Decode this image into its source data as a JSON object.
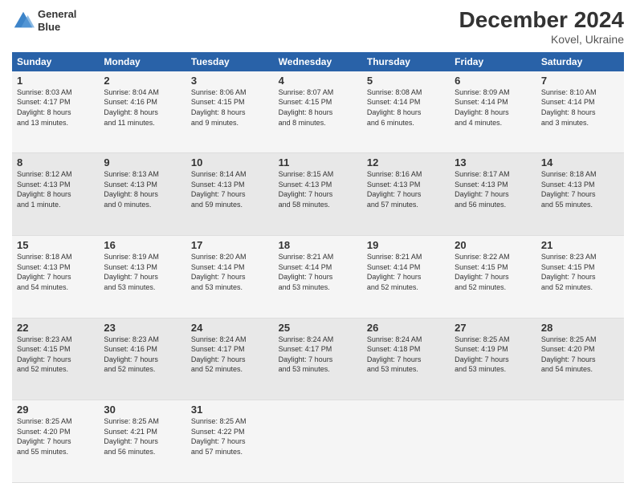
{
  "header": {
    "title": "December 2024",
    "subtitle": "Kovel, Ukraine",
    "logo_line1": "General",
    "logo_line2": "Blue"
  },
  "columns": [
    "Sunday",
    "Monday",
    "Tuesday",
    "Wednesday",
    "Thursday",
    "Friday",
    "Saturday"
  ],
  "weeks": [
    [
      {
        "day": "1",
        "info": "Sunrise: 8:03 AM\nSunset: 4:17 PM\nDaylight: 8 hours\nand 13 minutes."
      },
      {
        "day": "2",
        "info": "Sunrise: 8:04 AM\nSunset: 4:16 PM\nDaylight: 8 hours\nand 11 minutes."
      },
      {
        "day": "3",
        "info": "Sunrise: 8:06 AM\nSunset: 4:15 PM\nDaylight: 8 hours\nand 9 minutes."
      },
      {
        "day": "4",
        "info": "Sunrise: 8:07 AM\nSunset: 4:15 PM\nDaylight: 8 hours\nand 8 minutes."
      },
      {
        "day": "5",
        "info": "Sunrise: 8:08 AM\nSunset: 4:14 PM\nDaylight: 8 hours\nand 6 minutes."
      },
      {
        "day": "6",
        "info": "Sunrise: 8:09 AM\nSunset: 4:14 PM\nDaylight: 8 hours\nand 4 minutes."
      },
      {
        "day": "7",
        "info": "Sunrise: 8:10 AM\nSunset: 4:14 PM\nDaylight: 8 hours\nand 3 minutes."
      }
    ],
    [
      {
        "day": "8",
        "info": "Sunrise: 8:12 AM\nSunset: 4:13 PM\nDaylight: 8 hours\nand 1 minute."
      },
      {
        "day": "9",
        "info": "Sunrise: 8:13 AM\nSunset: 4:13 PM\nDaylight: 8 hours\nand 0 minutes."
      },
      {
        "day": "10",
        "info": "Sunrise: 8:14 AM\nSunset: 4:13 PM\nDaylight: 7 hours\nand 59 minutes."
      },
      {
        "day": "11",
        "info": "Sunrise: 8:15 AM\nSunset: 4:13 PM\nDaylight: 7 hours\nand 58 minutes."
      },
      {
        "day": "12",
        "info": "Sunrise: 8:16 AM\nSunset: 4:13 PM\nDaylight: 7 hours\nand 57 minutes."
      },
      {
        "day": "13",
        "info": "Sunrise: 8:17 AM\nSunset: 4:13 PM\nDaylight: 7 hours\nand 56 minutes."
      },
      {
        "day": "14",
        "info": "Sunrise: 8:18 AM\nSunset: 4:13 PM\nDaylight: 7 hours\nand 55 minutes."
      }
    ],
    [
      {
        "day": "15",
        "info": "Sunrise: 8:18 AM\nSunset: 4:13 PM\nDaylight: 7 hours\nand 54 minutes."
      },
      {
        "day": "16",
        "info": "Sunrise: 8:19 AM\nSunset: 4:13 PM\nDaylight: 7 hours\nand 53 minutes."
      },
      {
        "day": "17",
        "info": "Sunrise: 8:20 AM\nSunset: 4:14 PM\nDaylight: 7 hours\nand 53 minutes."
      },
      {
        "day": "18",
        "info": "Sunrise: 8:21 AM\nSunset: 4:14 PM\nDaylight: 7 hours\nand 53 minutes."
      },
      {
        "day": "19",
        "info": "Sunrise: 8:21 AM\nSunset: 4:14 PM\nDaylight: 7 hours\nand 52 minutes."
      },
      {
        "day": "20",
        "info": "Sunrise: 8:22 AM\nSunset: 4:15 PM\nDaylight: 7 hours\nand 52 minutes."
      },
      {
        "day": "21",
        "info": "Sunrise: 8:23 AM\nSunset: 4:15 PM\nDaylight: 7 hours\nand 52 minutes."
      }
    ],
    [
      {
        "day": "22",
        "info": "Sunrise: 8:23 AM\nSunset: 4:15 PM\nDaylight: 7 hours\nand 52 minutes."
      },
      {
        "day": "23",
        "info": "Sunrise: 8:23 AM\nSunset: 4:16 PM\nDaylight: 7 hours\nand 52 minutes."
      },
      {
        "day": "24",
        "info": "Sunrise: 8:24 AM\nSunset: 4:17 PM\nDaylight: 7 hours\nand 52 minutes."
      },
      {
        "day": "25",
        "info": "Sunrise: 8:24 AM\nSunset: 4:17 PM\nDaylight: 7 hours\nand 53 minutes."
      },
      {
        "day": "26",
        "info": "Sunrise: 8:24 AM\nSunset: 4:18 PM\nDaylight: 7 hours\nand 53 minutes."
      },
      {
        "day": "27",
        "info": "Sunrise: 8:25 AM\nSunset: 4:19 PM\nDaylight: 7 hours\nand 53 minutes."
      },
      {
        "day": "28",
        "info": "Sunrise: 8:25 AM\nSunset: 4:20 PM\nDaylight: 7 hours\nand 54 minutes."
      }
    ],
    [
      {
        "day": "29",
        "info": "Sunrise: 8:25 AM\nSunset: 4:20 PM\nDaylight: 7 hours\nand 55 minutes."
      },
      {
        "day": "30",
        "info": "Sunrise: 8:25 AM\nSunset: 4:21 PM\nDaylight: 7 hours\nand 56 minutes."
      },
      {
        "day": "31",
        "info": "Sunrise: 8:25 AM\nSunset: 4:22 PM\nDaylight: 7 hours\nand 57 minutes."
      },
      {
        "day": "",
        "info": ""
      },
      {
        "day": "",
        "info": ""
      },
      {
        "day": "",
        "info": ""
      },
      {
        "day": "",
        "info": ""
      }
    ]
  ]
}
